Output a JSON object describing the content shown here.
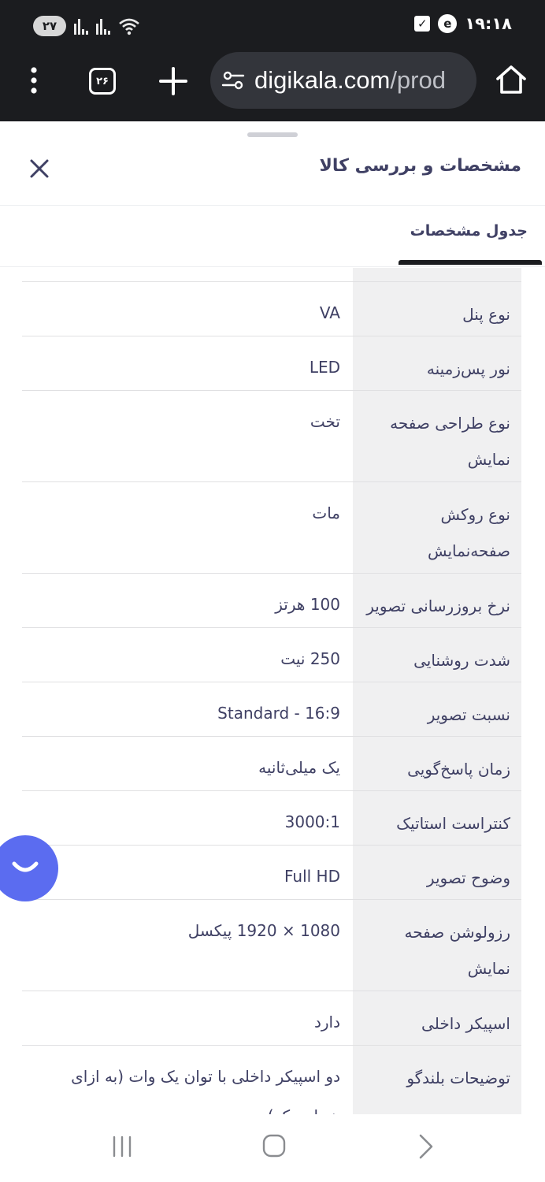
{
  "status_bar": {
    "time": "۱۹:۱۸",
    "notification_count": "۲۷",
    "icons": [
      "signal-icon",
      "signal-icon",
      "wifi-icon",
      "checkbox-icon",
      "digikala-icon"
    ]
  },
  "browser": {
    "tab_count": "۲۶",
    "url_domain": "digikala.com",
    "url_path": "/prod"
  },
  "sheet": {
    "title": "مشخصات و بررسی کالا",
    "tab_label": "جدول مشخصات"
  },
  "specs": [
    {
      "key": [
        "نوع پنل"
      ],
      "value": [
        "VA"
      ]
    },
    {
      "key": [
        "نور پس‌زمینه"
      ],
      "value": [
        "LED"
      ]
    },
    {
      "key": [
        "نوع طراحی صفحه",
        "نمایش"
      ],
      "value": [
        "تخت"
      ]
    },
    {
      "key": [
        "نوع روکش",
        "صفحه‌نمایش"
      ],
      "value": [
        "مات"
      ]
    },
    {
      "key": [
        "نرخ بروزرسانی تصویر"
      ],
      "value": [
        "100 هرتز"
      ]
    },
    {
      "key": [
        "شدت روشنایی"
      ],
      "value": [
        "250 نیت"
      ]
    },
    {
      "key": [
        "نسبت تصویر"
      ],
      "value": [
        "Standard - 16:9"
      ]
    },
    {
      "key": [
        "زمان پاسخ‌گویی"
      ],
      "value": [
        "یک میلی‌ثانیه"
      ]
    },
    {
      "key": [
        "کنتراست استاتیک"
      ],
      "value": [
        "3000:1"
      ]
    },
    {
      "key": [
        "وضوح تصویر"
      ],
      "value": [
        "Full HD"
      ]
    },
    {
      "key": [
        "رزولوشن صفحه",
        "نمایش"
      ],
      "value": [
        "1080 × 1920 پیکسل"
      ]
    },
    {
      "key": [
        "اسپیکر داخلی"
      ],
      "value": [
        "دارد"
      ]
    },
    {
      "key": [
        "توضیحات بلندگو"
      ],
      "value": [
        "دو اسپیکر داخلی با توان یک وات (به ازای",
        "هر اسپیکر)"
      ]
    }
  ],
  "colors": {
    "toolbar_bg": "#1b1c1f",
    "url_bar_bg": "#33353b",
    "key_column_bg": "#f0f0f1",
    "text": "#3f4064",
    "chat_button": "#5b6cf0"
  }
}
